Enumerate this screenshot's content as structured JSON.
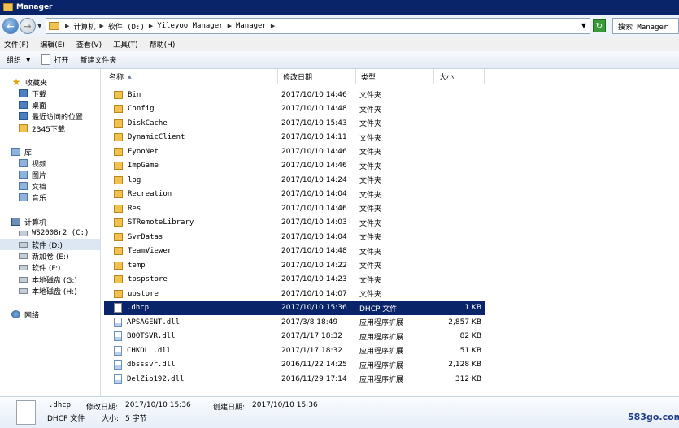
{
  "window": {
    "title": "Manager"
  },
  "address": {
    "crumbs": [
      "计算机",
      "软件 (D:)",
      "Yileyoo Manager",
      "Manager"
    ]
  },
  "search": {
    "placeholder": "搜索 Manager"
  },
  "menubar": [
    "文件(F)",
    "编辑(E)",
    "查看(V)",
    "工具(T)",
    "帮助(H)"
  ],
  "toolbar": {
    "organize": "组织",
    "open": "打开",
    "new_folder": "新建文件夹"
  },
  "nav": [
    {
      "label": "收藏夹",
      "icon": "star-icon"
    },
    {
      "label": "下载",
      "icon": "download-folder-icon"
    },
    {
      "label": "桌面",
      "icon": "desktop-icon"
    },
    {
      "label": "最近访问的位置",
      "icon": "recent-places-icon"
    },
    {
      "label": "2345下载",
      "icon": "folder-icon"
    },
    {
      "label": "库",
      "icon": "library-icon"
    },
    {
      "label": "视频",
      "icon": "videos-icon"
    },
    {
      "label": "图片",
      "icon": "pictures-icon"
    },
    {
      "label": "文档",
      "icon": "documents-icon"
    },
    {
      "label": "音乐",
      "icon": "music-icon"
    },
    {
      "label": "计算机",
      "icon": "computer-icon"
    },
    {
      "label": "WS2008r2 (C:)",
      "icon": "drive-icon"
    },
    {
      "label": "软件 (D:)",
      "icon": "drive-icon"
    },
    {
      "label": "新加卷 (E:)",
      "icon": "drive-icon"
    },
    {
      "label": "软件 (F:)",
      "icon": "drive-icon"
    },
    {
      "label": "本地磁盘 (G:)",
      "icon": "drive-icon"
    },
    {
      "label": "本地磁盘 (H:)",
      "icon": "drive-icon"
    },
    {
      "label": "网络",
      "icon": "network-icon"
    }
  ],
  "columns": [
    "名称",
    "修改日期",
    "类型",
    "大小"
  ],
  "files": [
    {
      "name": "Bin",
      "date": "2017/10/10 14:46",
      "type": "文件夹",
      "size": "",
      "kind": "folder"
    },
    {
      "name": "Config",
      "date": "2017/10/10 14:48",
      "type": "文件夹",
      "size": "",
      "kind": "folder"
    },
    {
      "name": "DiskCache",
      "date": "2017/10/10 15:43",
      "type": "文件夹",
      "size": "",
      "kind": "folder"
    },
    {
      "name": "DynamicClient",
      "date": "2017/10/10 14:11",
      "type": "文件夹",
      "size": "",
      "kind": "folder"
    },
    {
      "name": "EyooNet",
      "date": "2017/10/10 14:46",
      "type": "文件夹",
      "size": "",
      "kind": "folder"
    },
    {
      "name": "ImpGame",
      "date": "2017/10/10 14:46",
      "type": "文件夹",
      "size": "",
      "kind": "folder"
    },
    {
      "name": "log",
      "date": "2017/10/10 14:24",
      "type": "文件夹",
      "size": "",
      "kind": "folder"
    },
    {
      "name": "Recreation",
      "date": "2017/10/10 14:04",
      "type": "文件夹",
      "size": "",
      "kind": "folder"
    },
    {
      "name": "Res",
      "date": "2017/10/10 14:46",
      "type": "文件夹",
      "size": "",
      "kind": "folder"
    },
    {
      "name": "STRemoteLibrary",
      "date": "2017/10/10 14:03",
      "type": "文件夹",
      "size": "",
      "kind": "folder"
    },
    {
      "name": "SvrDatas",
      "date": "2017/10/10 14:04",
      "type": "文件夹",
      "size": "",
      "kind": "folder"
    },
    {
      "name": "TeamViewer",
      "date": "2017/10/10 14:48",
      "type": "文件夹",
      "size": "",
      "kind": "folder"
    },
    {
      "name": "temp",
      "date": "2017/10/10 14:22",
      "type": "文件夹",
      "size": "",
      "kind": "folder"
    },
    {
      "name": "tpspstore",
      "date": "2017/10/10 14:23",
      "type": "文件夹",
      "size": "",
      "kind": "folder"
    },
    {
      "name": "upstore",
      "date": "2017/10/10 14:07",
      "type": "文件夹",
      "size": "",
      "kind": "folder"
    },
    {
      "name": ".dhcp",
      "date": "2017/10/10 15:36",
      "type": "DHCP 文件",
      "size": "1 KB",
      "kind": "file",
      "selected": true
    },
    {
      "name": "APSAGENT.dll",
      "date": "2017/3/8 18:49",
      "type": "应用程序扩展",
      "size": "2,857 KB",
      "kind": "dll"
    },
    {
      "name": "BOOTSVR.dll",
      "date": "2017/1/17 18:32",
      "type": "应用程序扩展",
      "size": "82 KB",
      "kind": "dll"
    },
    {
      "name": "CHKDLL.dll",
      "date": "2017/1/17 18:32",
      "type": "应用程序扩展",
      "size": "51 KB",
      "kind": "dll"
    },
    {
      "name": "dbsssvr.dll",
      "date": "2016/11/22 14:25",
      "type": "应用程序扩展",
      "size": "2,128 KB",
      "kind": "dll"
    },
    {
      "name": "DelZip192.dll",
      "date": "2016/11/29 17:14",
      "type": "应用程序扩展",
      "size": "312 KB",
      "kind": "dll"
    }
  ],
  "details": {
    "name": ".dhcp",
    "type": "DHCP 文件",
    "modified_label": "修改日期:",
    "modified": "2017/10/10 15:36",
    "created_label": "创建日期:",
    "created": "2017/10/10 15:36",
    "size_label": "大小:",
    "size": "5 字节"
  },
  "watermark": "583go.com"
}
